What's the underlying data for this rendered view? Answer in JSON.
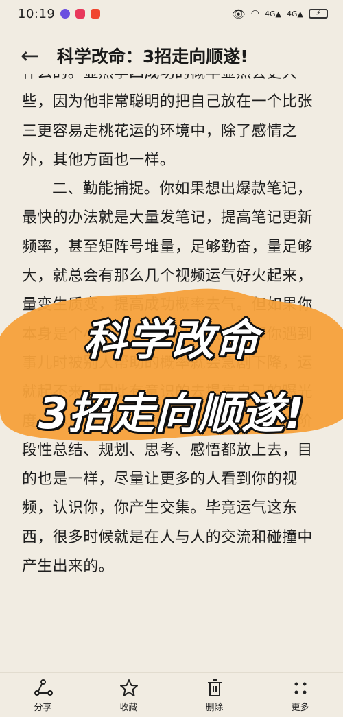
{
  "status_bar": {
    "time": "10:19",
    "signal_1": "4G",
    "signal_2": "4G",
    "colors": {
      "app1": "#6a4fe0",
      "app2": "#e8385b",
      "app3": "#f0452e"
    }
  },
  "header": {
    "title": "科学改命：3招走向顺遂!"
  },
  "article": {
    "paragraphs": [
      "什么的。显然李四成功的概率显然会更大一些，因为他非常聪明的把自己放在一个比张三更容易走桃花运的环境中，除了感情之外，其他方面也一样。",
      "二、勤能捕捉。你如果想出爆款笔记，最快的办法就是大量发笔记，提高笔记更新频率，甚至矩阵号堆量，足够勤奋，量足够大，就总会有那么几个视频运气好火起来，量变生质变，提高成功概率去气。但如果你本身是个小透明，根本没谁认识你那你遇到事儿时被别人帮助的概率就会急剧下降，运就起不来。因此有意识的去提高自己的曝光度，尽可能多出现在众人面前，把自己的阶段性总结、规划、思考、感悟都放上去，目的也是一样，尽量让更多的人看到你的视频，认识你，你产生交集。毕竟运气这东西，很多时候就是在人与人的交流和碰撞中产生出来的。"
    ]
  },
  "overlay": {
    "line1": "科学改命",
    "line2": "3招走向顺遂!",
    "blob_color": "#f5a13b"
  },
  "bottom_bar": {
    "share": "分享",
    "favorite": "收藏",
    "delete": "删除",
    "more": "更多"
  }
}
